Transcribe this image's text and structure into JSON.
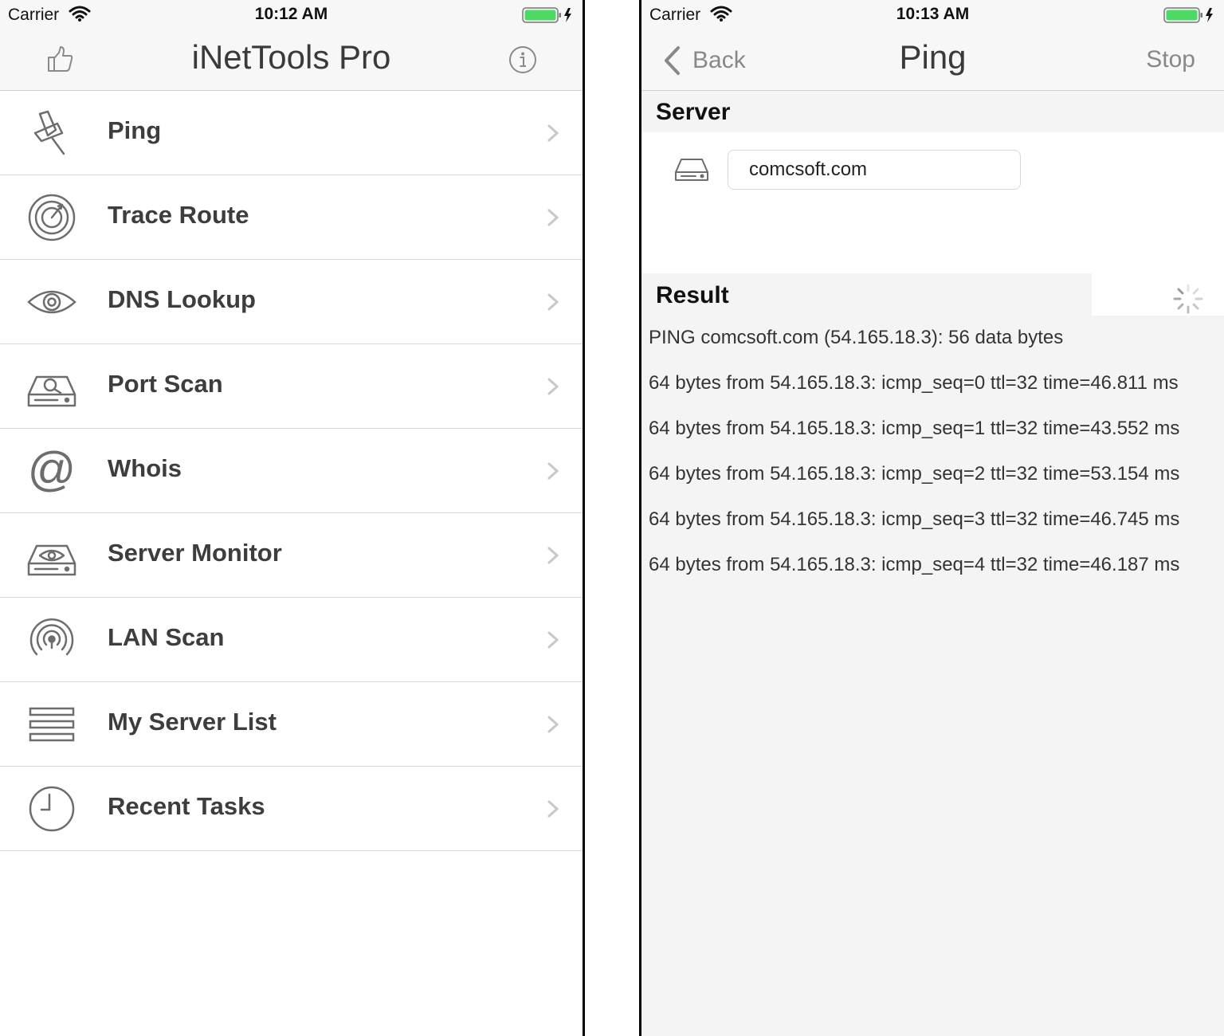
{
  "left": {
    "status": {
      "carrier": "Carrier",
      "time": "10:12 AM"
    },
    "nav": {
      "title": "iNetTools Pro",
      "left_icon": "thumbs-up-icon",
      "right_icon": "info-icon"
    },
    "menu": [
      {
        "label": "Ping",
        "icon": "pushpin-icon"
      },
      {
        "label": "Trace Route",
        "icon": "radar-icon"
      },
      {
        "label": "DNS Lookup",
        "icon": "eye-icon"
      },
      {
        "label": "Port Scan",
        "icon": "drive-search-icon"
      },
      {
        "label": "Whois",
        "icon": "at-sign-icon"
      },
      {
        "label": "Server Monitor",
        "icon": "drive-eye-icon"
      },
      {
        "label": "LAN Scan",
        "icon": "broadcast-icon"
      },
      {
        "label": "My Server List",
        "icon": "list-icon"
      },
      {
        "label": "Recent Tasks",
        "icon": "clock-icon"
      }
    ]
  },
  "right": {
    "status": {
      "carrier": "Carrier",
      "time": "10:13 AM"
    },
    "nav": {
      "back_label": "Back",
      "title": "Ping",
      "stop_label": "Stop"
    },
    "server": {
      "header": "Server",
      "value": "comcsoft.com"
    },
    "result": {
      "header": "Result",
      "lines": [
        "PING comcsoft.com (54.165.18.3): 56 data bytes",
        "64 bytes from 54.165.18.3: icmp_seq=0 ttl=32 time=46.811 ms",
        "64 bytes from 54.165.18.3: icmp_seq=1 ttl=32 time=43.552 ms",
        "64 bytes from 54.165.18.3: icmp_seq=2 ttl=32 time=53.154 ms",
        "64 bytes from 54.165.18.3: icmp_seq=3 ttl=32 time=46.745 ms",
        "64 bytes from 54.165.18.3: icmp_seq=4 ttl=32 time=46.187 ms"
      ]
    }
  },
  "colors": {
    "battery": "#4cd964",
    "icon_gray": "#6d6d6d",
    "chevron": "#c7c7cc",
    "header_bg": "#f4f4f4"
  }
}
